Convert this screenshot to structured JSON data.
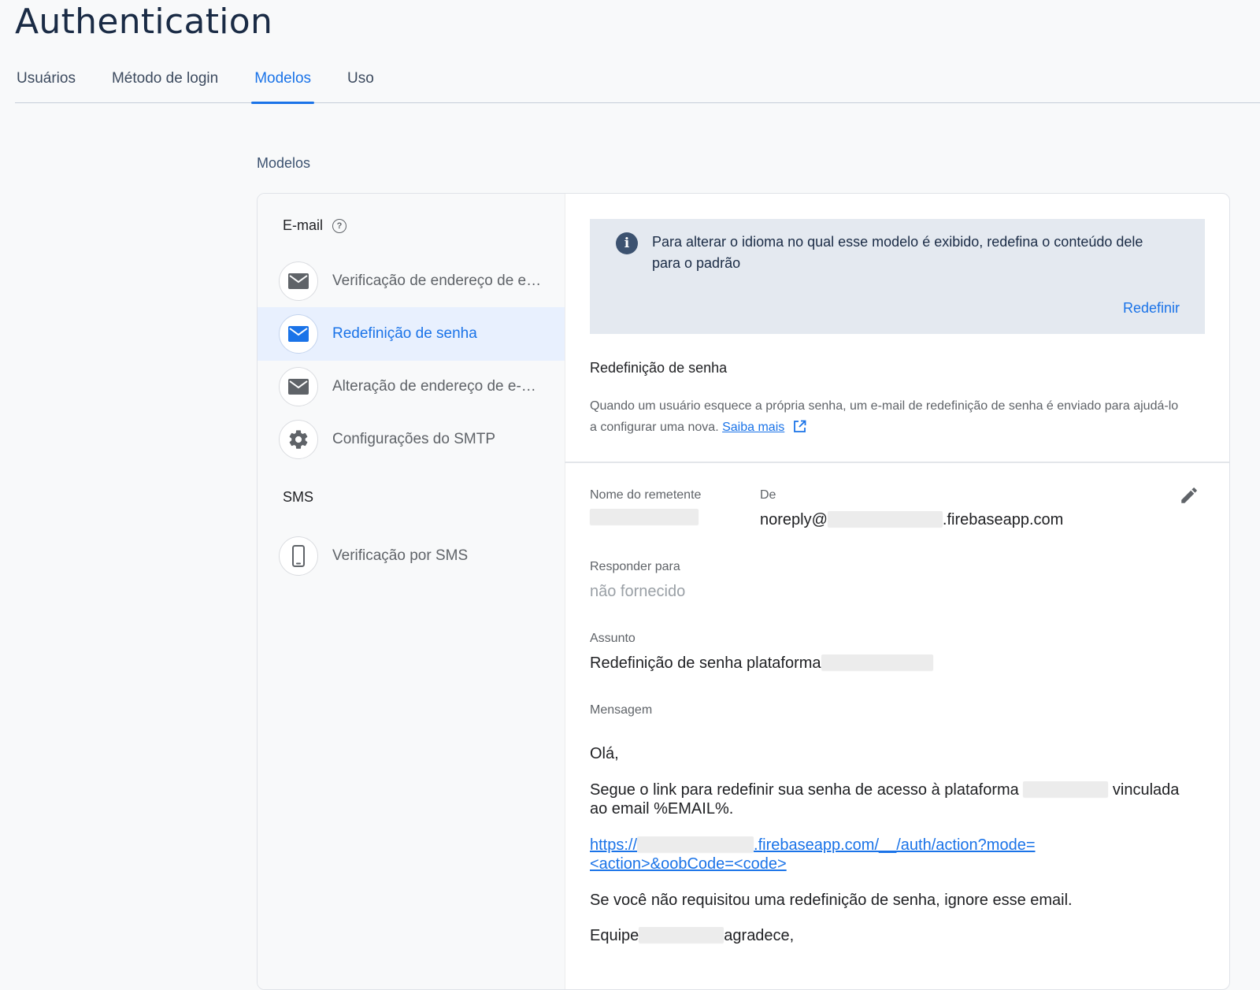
{
  "page": {
    "title": "Authentication"
  },
  "tabs": [
    {
      "label": "Usuários"
    },
    {
      "label": "Método de login"
    },
    {
      "label": "Modelos"
    },
    {
      "label": "Uso"
    }
  ],
  "section": {
    "title": "Modelos"
  },
  "sidebar": {
    "email_label": "E-mail",
    "sms_label": "SMS",
    "items": [
      {
        "label": "Verificação de endereço de e-mail",
        "icon": "mail-icon"
      },
      {
        "label": "Redefinição de senha",
        "icon": "mail-icon",
        "selected": true
      },
      {
        "label": "Alteração de endereço de e-mail",
        "icon": "mail-icon"
      },
      {
        "label": "Configurações do SMTP",
        "icon": "gear-icon"
      },
      {
        "label": "Verificação por SMS",
        "icon": "phone-icon"
      }
    ]
  },
  "info": {
    "text": "Para alterar o idioma no qual esse modelo é exibido, redefina o conteúdo dele para o padrão",
    "reset_label": "Redefinir"
  },
  "template": {
    "title": "Redefinição de senha",
    "description": "Quando um usuário esquece a própria senha, um e-mail de redefinição de senha é enviado para ajudá-lo a configurar uma nova.",
    "learn_more": "Saiba mais"
  },
  "fields": {
    "sender_label": "Nome do remetente",
    "from_label": "De",
    "from_prefix": "noreply@",
    "from_suffix": ".firebaseapp.com",
    "reply_label": "Responder para",
    "reply_value": "não fornecido",
    "subject_label": "Assunto",
    "subject_value": "Redefinição de senha plataforma",
    "message_label": "Mensagem"
  },
  "message": {
    "greeting": "Olá,",
    "line1_a": "Segue o link para redefinir sua senha de acesso à plataforma",
    "line1_b": "vinculada",
    "line1_c": "ao email %EMAIL%.",
    "link_prefix": "https://",
    "link_suffix": ".firebaseapp.com/__/auth/action?mode=",
    "link_line2": "<action>&oobCode=<code>",
    "ignore": "Se você não requisitou uma redefinição de senha, ignore esse email.",
    "team_a": "Equipe",
    "team_b": "agradece,"
  },
  "colors": {
    "accent": "#1a73e8",
    "info_bg": "#e4e9f0",
    "selected_bg": "#e8f0fe"
  }
}
